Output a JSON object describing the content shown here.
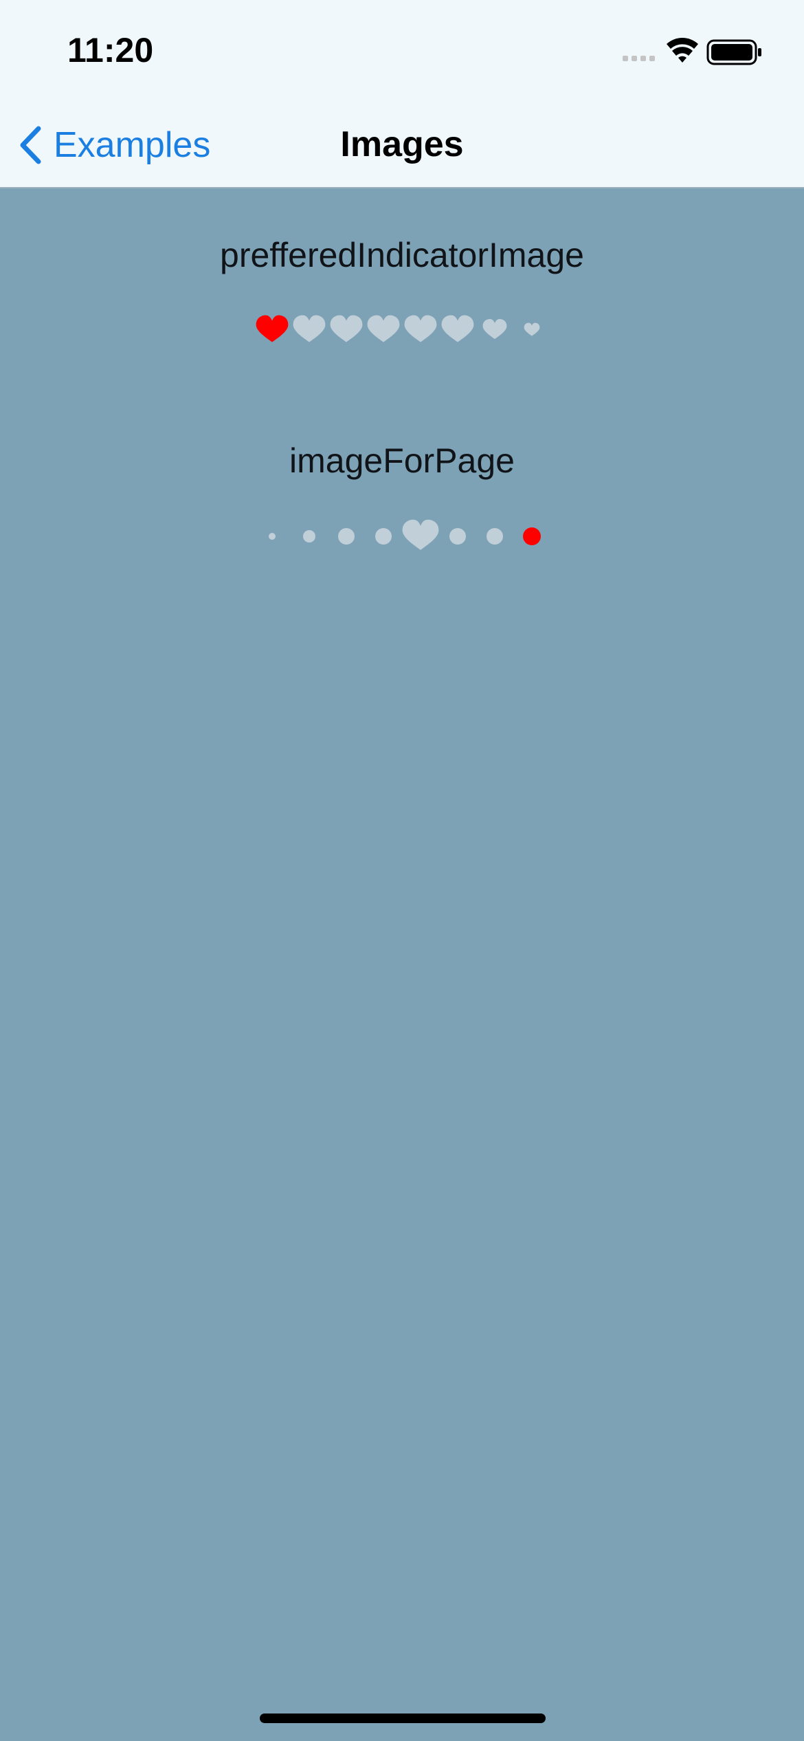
{
  "status_bar": {
    "time": "11:20",
    "icons": [
      "cellular-signal-icon",
      "wifi-icon",
      "battery-icon"
    ]
  },
  "nav": {
    "back_label": "Examples",
    "back_icon": "chevron-left-icon",
    "title": "Images"
  },
  "sections": [
    {
      "title": "prefferedIndicatorImage",
      "page_count": 8,
      "current_page": 1,
      "indicator_icons": [
        "heart-icon",
        "heart-icon",
        "heart-icon",
        "heart-icon",
        "heart-icon",
        "heart-icon",
        "heart-icon",
        "heart-icon"
      ]
    },
    {
      "title": "imageForPage",
      "page_count": 8,
      "current_page": 8,
      "indicator_icons": [
        "dot-icon",
        "dot-icon",
        "dot-icon",
        "dot-icon",
        "heart-icon",
        "dot-icon",
        "dot-icon",
        "dot-icon"
      ]
    }
  ],
  "colors": {
    "background": "#7ea2b5",
    "bar_background": "#f1f8fc",
    "accent": "#1b7fe2",
    "indicator_active": "#ff0000",
    "indicator_inactive": "#c1cfd8"
  }
}
